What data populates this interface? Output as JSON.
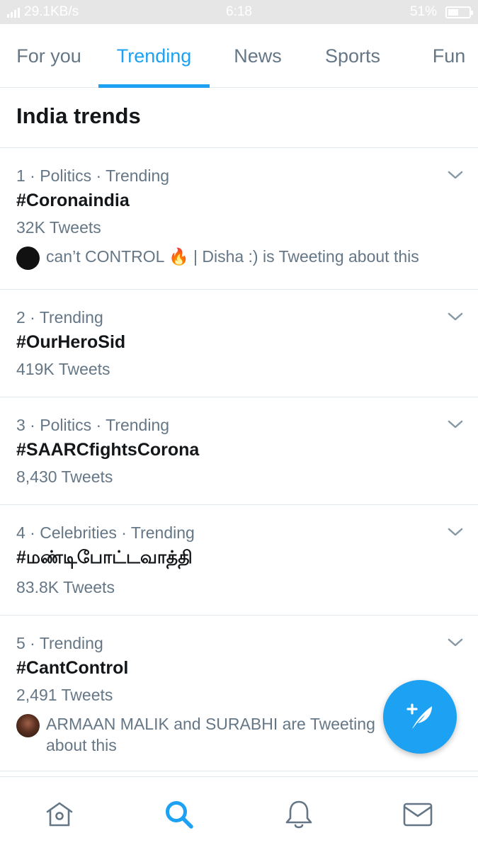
{
  "status_bar": {
    "network_speed": "29.1KB/s",
    "time": "6:18",
    "battery_percent": "51%",
    "battery_level": 0.51
  },
  "tabs": [
    {
      "label": "For you",
      "active": false
    },
    {
      "label": "Trending",
      "active": true
    },
    {
      "label": "News",
      "active": false
    },
    {
      "label": "Sports",
      "active": false
    },
    {
      "label": "Fun",
      "active": false
    }
  ],
  "section_title": "India trends",
  "trends": [
    {
      "meta": "1 · Politics · Trending",
      "name": "#Coronaindia",
      "count": "32K Tweets",
      "context": "can’t CONTROL 🔥 | Disha :) is Tweeting about this",
      "avatar_color": "#111111"
    },
    {
      "meta": "2 · Trending",
      "name": "#OurHeroSid",
      "count": "419K Tweets"
    },
    {
      "meta": "3 · Politics · Trending",
      "name": "#SAARCfightsCorona",
      "count": "8,430 Tweets"
    },
    {
      "meta": "4 · Celebrities · Trending",
      "name": "#மண்டிபோட்டவாத்தி",
      "count": "83.8K Tweets"
    },
    {
      "meta": "5 · Trending",
      "name": "#CantControl",
      "count": "2,491 Tweets",
      "context": "ARMAAN MALIK and SURABHI are Tweeting about this",
      "avatar_color": "#5a3020"
    }
  ],
  "bottom_nav": [
    {
      "icon": "home-icon"
    },
    {
      "icon": "search-icon",
      "active": true
    },
    {
      "icon": "bell-icon"
    },
    {
      "icon": "mail-icon"
    }
  ],
  "fab": {
    "icon": "compose-tweet-icon"
  },
  "colors": {
    "accent": "#1da1f2",
    "secondary_text": "#657786",
    "primary_text": "#14171a",
    "divider": "#e1e8ed"
  }
}
